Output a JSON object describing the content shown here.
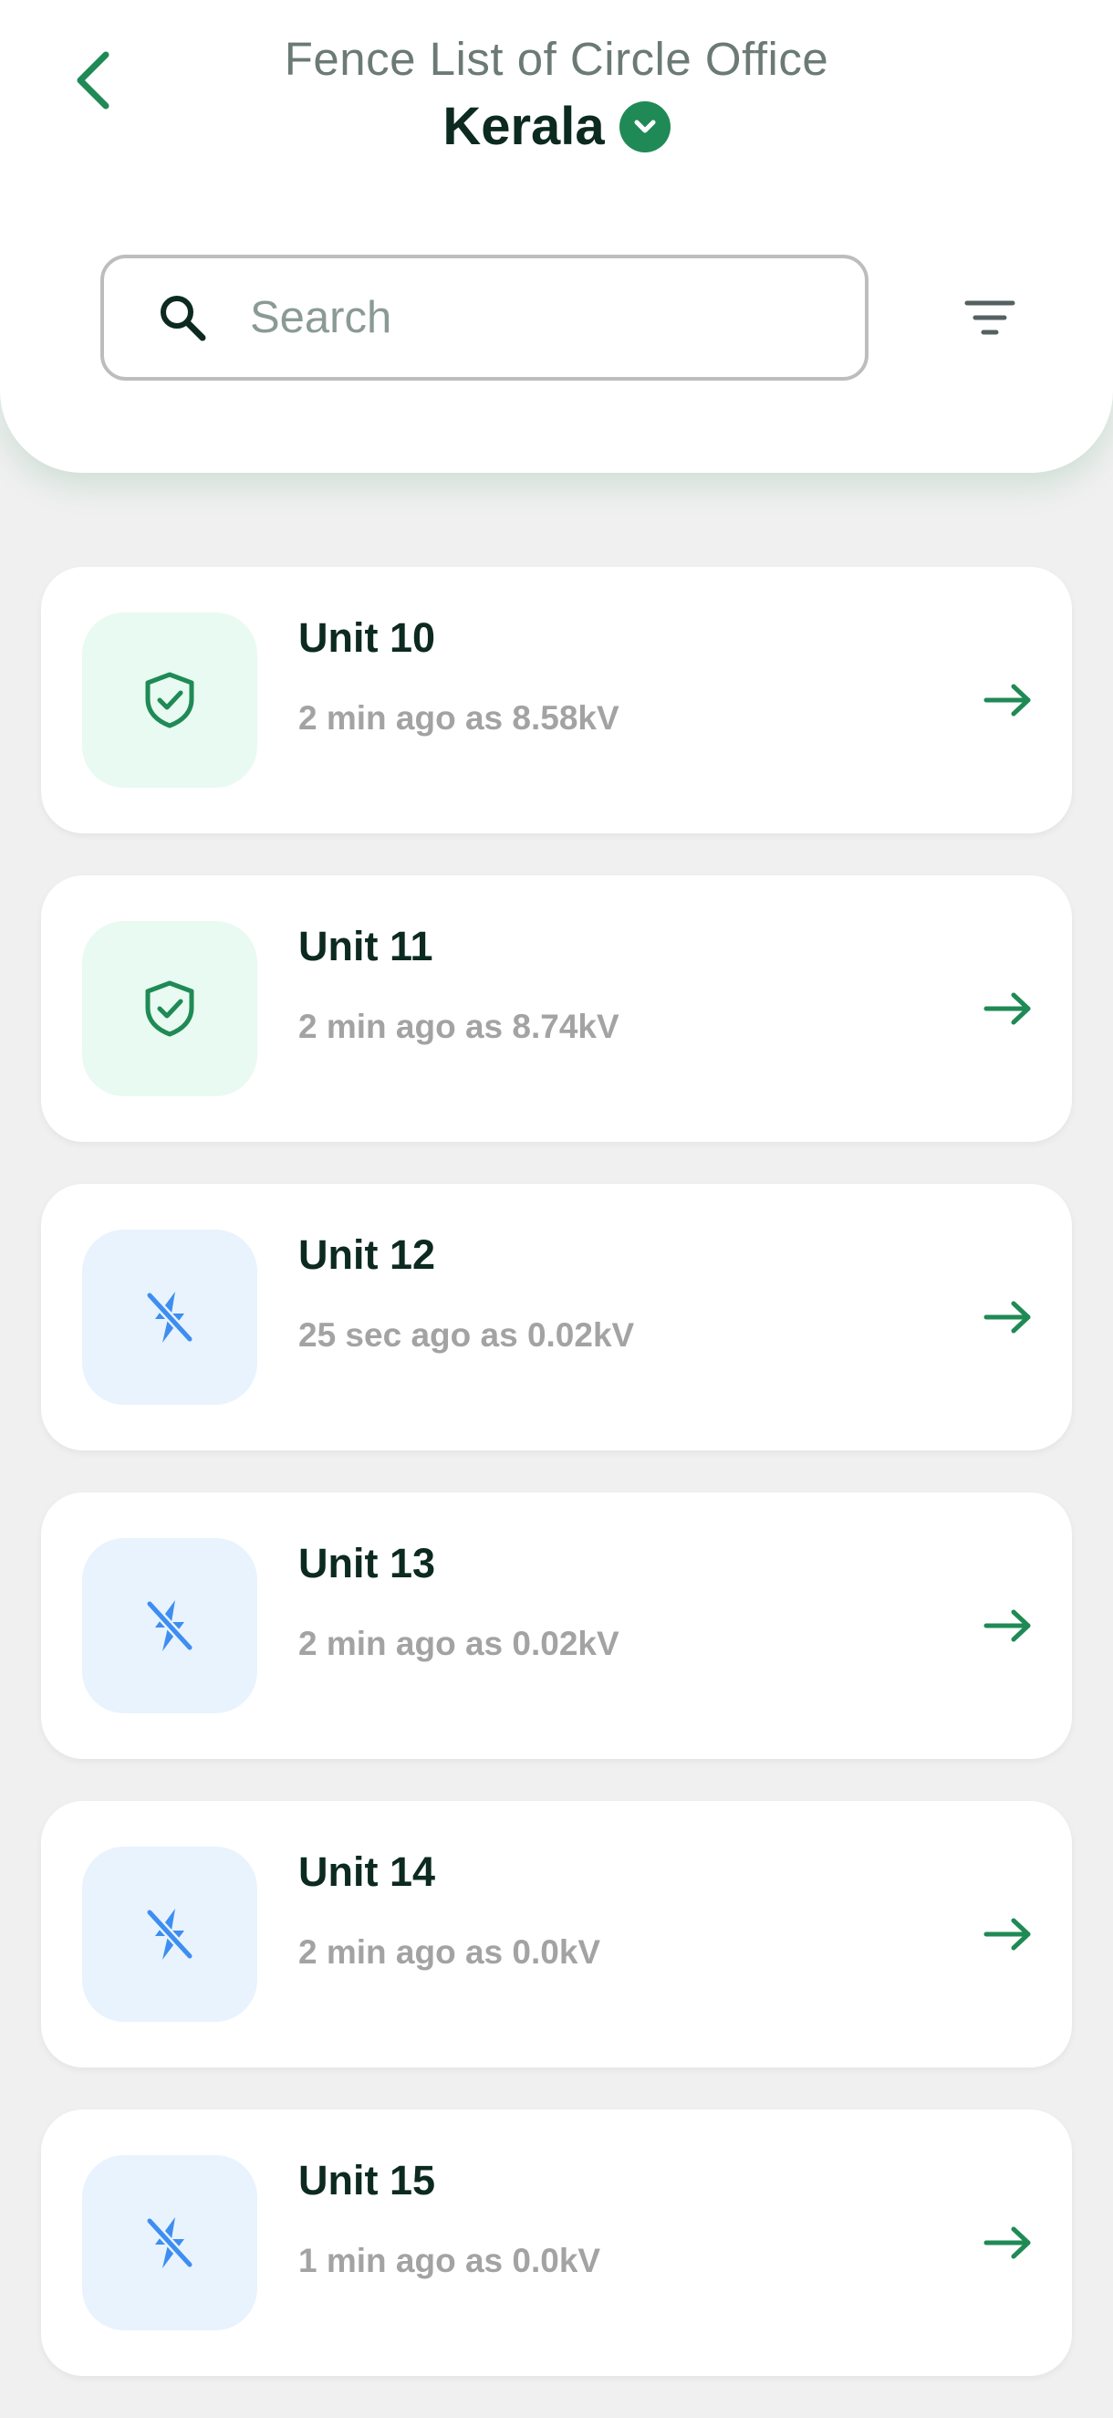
{
  "header": {
    "subtitle": "Fence List of Circle Office",
    "office_name": "Kerala"
  },
  "search": {
    "placeholder": "Search",
    "value": ""
  },
  "colors": {
    "accent": "#1f8a55",
    "safe_icon": "#1f8a55",
    "safe_bg": "#e8faf1",
    "off_icon": "#3d8ef0",
    "off_bg": "#e9f3fe"
  },
  "units": [
    {
      "name": "Unit 10",
      "status": "2 min ago as 8.58kV",
      "icon": "shield-check-icon"
    },
    {
      "name": "Unit 11",
      "status": "2 min ago as 8.74kV",
      "icon": "shield-check-icon"
    },
    {
      "name": "Unit 12",
      "status": "25 sec ago as 0.02kV",
      "icon": "power-off-icon"
    },
    {
      "name": "Unit 13",
      "status": "2 min ago as 0.02kV",
      "icon": "power-off-icon"
    },
    {
      "name": "Unit 14",
      "status": "2 min ago as 0.0kV",
      "icon": "power-off-icon"
    },
    {
      "name": "Unit 15",
      "status": "1 min ago as 0.0kV",
      "icon": "power-off-icon"
    }
  ]
}
